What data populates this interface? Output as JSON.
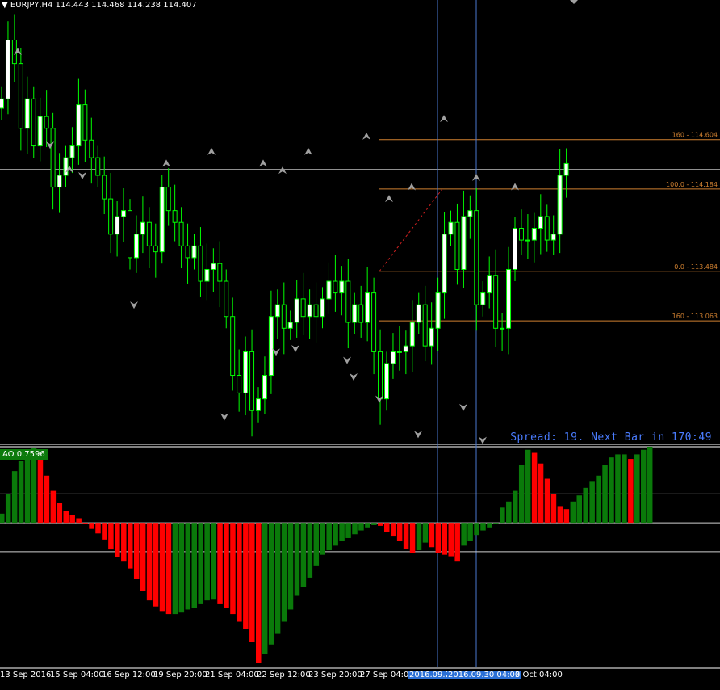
{
  "header": {
    "symbol": "EURJPY,H4",
    "open": "114.443",
    "high": "114.468",
    "low": "114.238",
    "close": "114.407"
  },
  "spread_text": "Spread: 19. Next Bar in 170:49",
  "ao_label": "AO 0.7596",
  "x_axis_labels": [
    {
      "text": "13 Sep 2016",
      "hl": false
    },
    {
      "text": "15 Sep 04:00",
      "hl": false
    },
    {
      "text": "16 Sep 12:00",
      "hl": false
    },
    {
      "text": "19 Sep 20:00",
      "hl": false
    },
    {
      "text": "21 Sep 04:00",
      "hl": false
    },
    {
      "text": "22 Sep 12:00",
      "hl": false
    },
    {
      "text": "23 Sep 20:00",
      "hl": false
    },
    {
      "text": "27 Sep 04:00",
      "hl": false
    },
    {
      "text": "2016.09.25",
      "hl": true
    },
    {
      "text": "2016.09.30 04:00",
      "hl": true
    },
    {
      "text": "3 Oct 04:00",
      "hl": false
    }
  ],
  "colors": {
    "background": "#000000",
    "candle_up": "#ffffff",
    "candle_down": "#000000",
    "candle_outline": "#00ff00",
    "fibo": "#d08030",
    "ao_up": "#0a7a0a",
    "ao_down": "#ff0000",
    "vline": "#4a78d0",
    "spread_text": "#4a7cff"
  },
  "chart_data": [
    {
      "type": "candlestick",
      "symbol": "EURJPY",
      "timeframe": "H4",
      "ylim": [
        112.02,
        115.79
      ],
      "hline": 114.35,
      "fibonacci_levels": [
        {
          "label": "160  -  114.604",
          "value": 114.604
        },
        {
          "label": "100.0  -  114.184",
          "value": 114.184
        },
        {
          "label": "0.0  -  113.484",
          "value": 113.484
        },
        {
          "label": "160  -  113.063",
          "value": 113.063
        }
      ],
      "candles_close": [
        114.95,
        115.45,
        115.25,
        114.7,
        114.95,
        114.55,
        114.8,
        114.7,
        114.2,
        114.3,
        114.45,
        114.55,
        114.9,
        114.6,
        114.45,
        114.3,
        114.1,
        113.8,
        113.95,
        114.0,
        113.6,
        113.8,
        113.9,
        113.7,
        113.65,
        114.2,
        114.0,
        113.9,
        113.7,
        113.6,
        113.7,
        113.4,
        113.5,
        113.55,
        113.4,
        113.1,
        112.6,
        112.45,
        112.8,
        112.3,
        112.4,
        112.6,
        113.1,
        113.2,
        113.0,
        113.05,
        113.25,
        113.1,
        113.2,
        113.1,
        113.25,
        113.4,
        113.3,
        113.4,
        113.05,
        113.2,
        113.05,
        113.3,
        112.8,
        112.4,
        112.7,
        112.8,
        112.8,
        112.85,
        113.05,
        113.2,
        112.85,
        113.0,
        113.3,
        113.8,
        113.9,
        113.5,
        113.95,
        114.0,
        113.2,
        113.3,
        113.45,
        113.0,
        113.0,
        113.5,
        113.85,
        113.75,
        113.75,
        113.85,
        113.95,
        113.75,
        113.8,
        114.3,
        114.4
      ],
      "fractals_up": [
        115.35,
        114.35,
        114.5,
        114.4,
        114.4,
        114.34,
        114.5,
        114.63,
        114.78,
        114.28,
        114.2,
        114.2,
        114.1
      ],
      "fractals_down": [
        114.56,
        114.3,
        113.2,
        112.25,
        112.8,
        112.83,
        112.73,
        112.59,
        112.4,
        112.1,
        112.33,
        112.05
      ],
      "vertical_lines": [
        "2016.09.25",
        "2016.09.30 04:00"
      ]
    },
    {
      "type": "bar",
      "name": "AO",
      "value": 0.7596,
      "ylim": [
        -1.9,
        1.0
      ],
      "hlines": [
        0.38,
        -0.38
      ],
      "values": [
        0.12,
        0.38,
        0.68,
        0.82,
        0.92,
        0.98,
        0.88,
        0.62,
        0.42,
        0.26,
        0.16,
        0.1,
        0.06,
        0.0,
        -0.08,
        -0.14,
        -0.22,
        -0.35,
        -0.45,
        -0.5,
        -0.6,
        -0.74,
        -0.9,
        -1.02,
        -1.1,
        -1.16,
        -1.2,
        -1.2,
        -1.18,
        -1.14,
        -1.12,
        -1.06,
        -1.02,
        -1.0,
        -1.06,
        -1.12,
        -1.2,
        -1.3,
        -1.4,
        -1.57,
        -1.84,
        -1.72,
        -1.6,
        -1.46,
        -1.3,
        -1.14,
        -0.96,
        -0.84,
        -0.72,
        -0.56,
        -0.42,
        -0.36,
        -0.3,
        -0.24,
        -0.2,
        -0.15,
        -0.1,
        -0.06,
        -0.03,
        -0.04,
        -0.12,
        -0.18,
        -0.24,
        -0.34,
        -0.4,
        -0.36,
        -0.26,
        -0.32,
        -0.4,
        -0.42,
        -0.44,
        -0.5,
        -0.3,
        -0.24,
        -0.16,
        -0.1,
        -0.06,
        0.0,
        0.2,
        0.28,
        0.42,
        0.76,
        0.96,
        0.92,
        0.78,
        0.58,
        0.38,
        0.22,
        0.18,
        0.28,
        0.36,
        0.46,
        0.55,
        0.62,
        0.76,
        0.86,
        0.9,
        0.9,
        0.84,
        0.9,
        0.96,
        1.0
      ]
    }
  ]
}
